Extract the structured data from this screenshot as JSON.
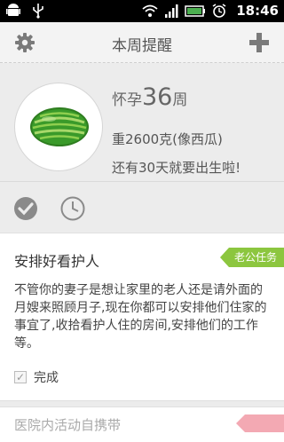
{
  "status_bar": {
    "time": "18:46",
    "icons_left": [
      "android-icon",
      "usb-icon"
    ],
    "icons_right": [
      "wifi-icon",
      "signal-icon",
      "battery-icon",
      "alarm-icon"
    ]
  },
  "header": {
    "title": "本周提醒",
    "left_icon": "gear-icon",
    "right_icon": "plus-icon"
  },
  "summary": {
    "week_prefix": "怀孕",
    "week_number": "36",
    "week_suffix": "周",
    "weight_text": "重2600克(像西瓜)",
    "days_text": "还有30天就要出生啦!"
  },
  "tabs": [
    {
      "icon": "check-circle-icon"
    },
    {
      "icon": "clock-icon"
    }
  ],
  "reminder": {
    "title": "安排好看护人",
    "tag": "老公任务",
    "tag_color": "#8cc63f",
    "body": "不管你的妻子是想让家里的老人还是请外面的月嫂来照顾月子,现在你都可以安排他们住家的事宜了,收拾看护人住的房间,安排他们的工作等。",
    "done_label": "完成"
  },
  "next_reminder": {
    "title": "医院内活动自携带",
    "tag_color": "#f3a9b3"
  }
}
